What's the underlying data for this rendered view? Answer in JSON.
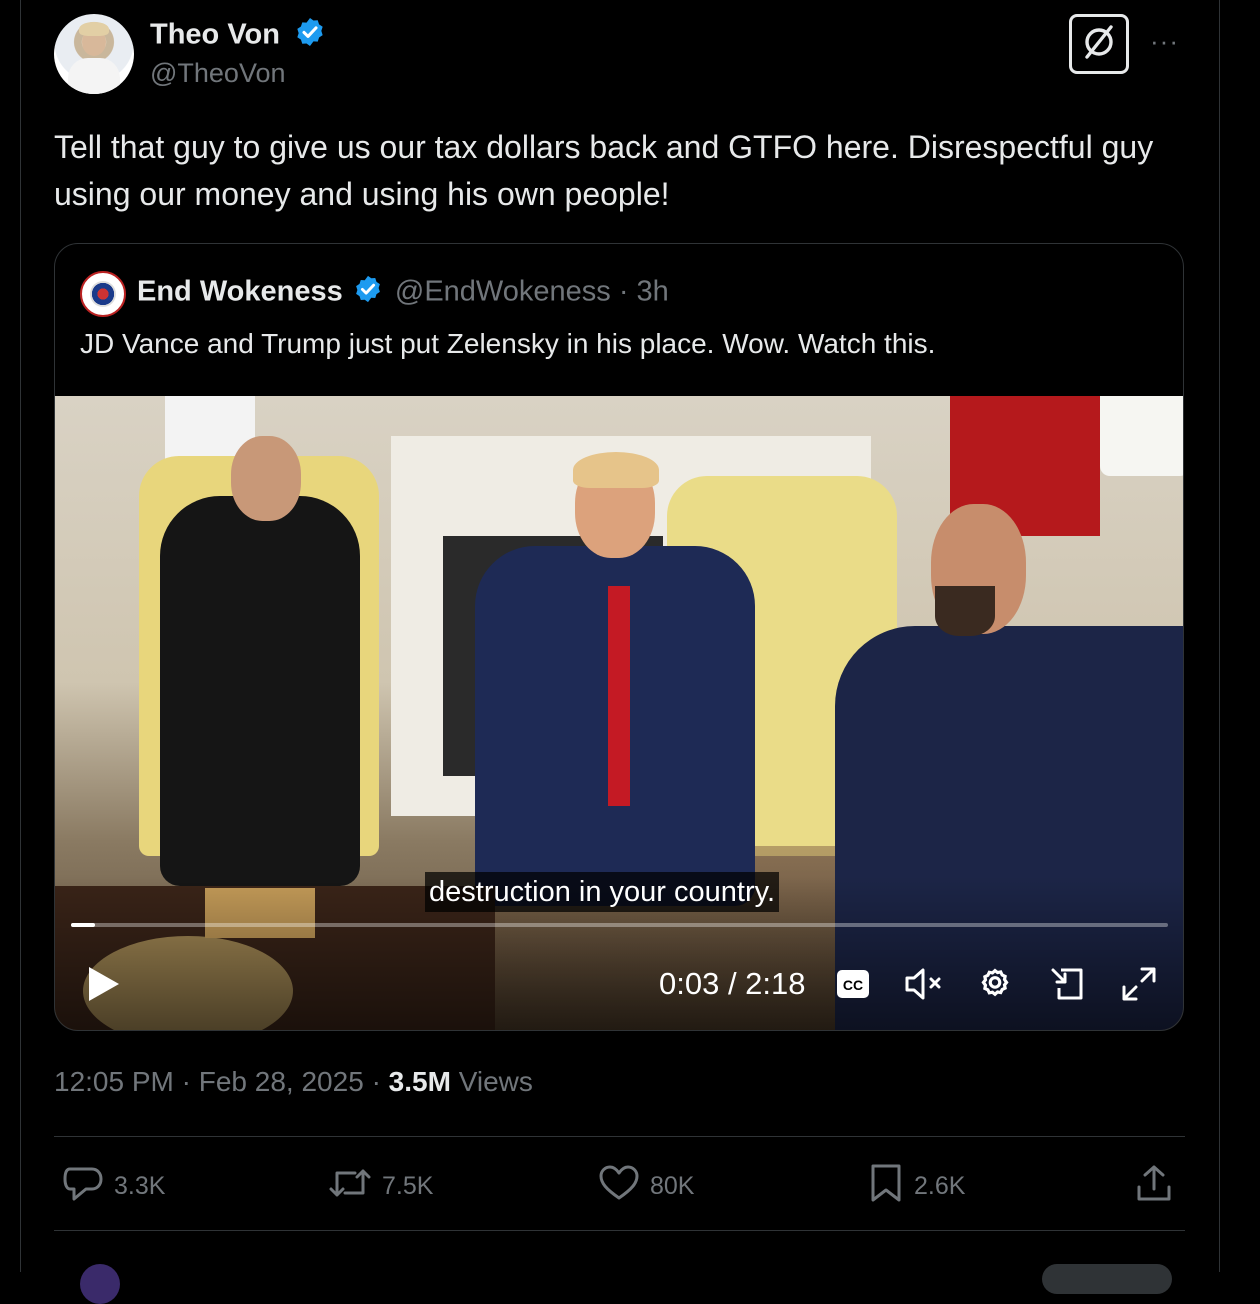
{
  "tweet": {
    "author_name": "Theo Von",
    "author_handle": "@TheoVon",
    "text": "Tell that guy to give us our tax dollars back and GTFO here.  Disrespectful guy using our money and using his own people!",
    "time": "12:05 PM",
    "date": "Feb 28, 2025",
    "separator": "·",
    "views_count": "3.5M",
    "views_label": "Views",
    "more_label": "···"
  },
  "quote": {
    "author_name": "End Wokeness",
    "author_handle": "@EndWokeness",
    "age": "· 3h",
    "text": "JD Vance and Trump just put Zelensky in his place. Wow. Watch this."
  },
  "video": {
    "caption": "destruction in your country.",
    "time_display": "0:03 / 2:18",
    "progress": 0.022
  },
  "actions": {
    "replies": "3.3K",
    "reposts": "7.5K",
    "likes": "80K",
    "bookmarks": "2.6K"
  },
  "colors": {
    "background": "#000000",
    "text": "#e7e9ea",
    "muted": "#71767b",
    "verified": "#1d9bf0",
    "border": "#2f3336"
  },
  "icons": [
    "verified-badge-icon",
    "grok-icon",
    "more-icon",
    "play-icon",
    "closed-captions-icon",
    "muted-volume-icon",
    "settings-gear-icon",
    "picture-in-picture-icon",
    "fullscreen-icon",
    "reply-icon",
    "repost-icon",
    "like-heart-icon",
    "bookmark-icon",
    "share-icon"
  ]
}
